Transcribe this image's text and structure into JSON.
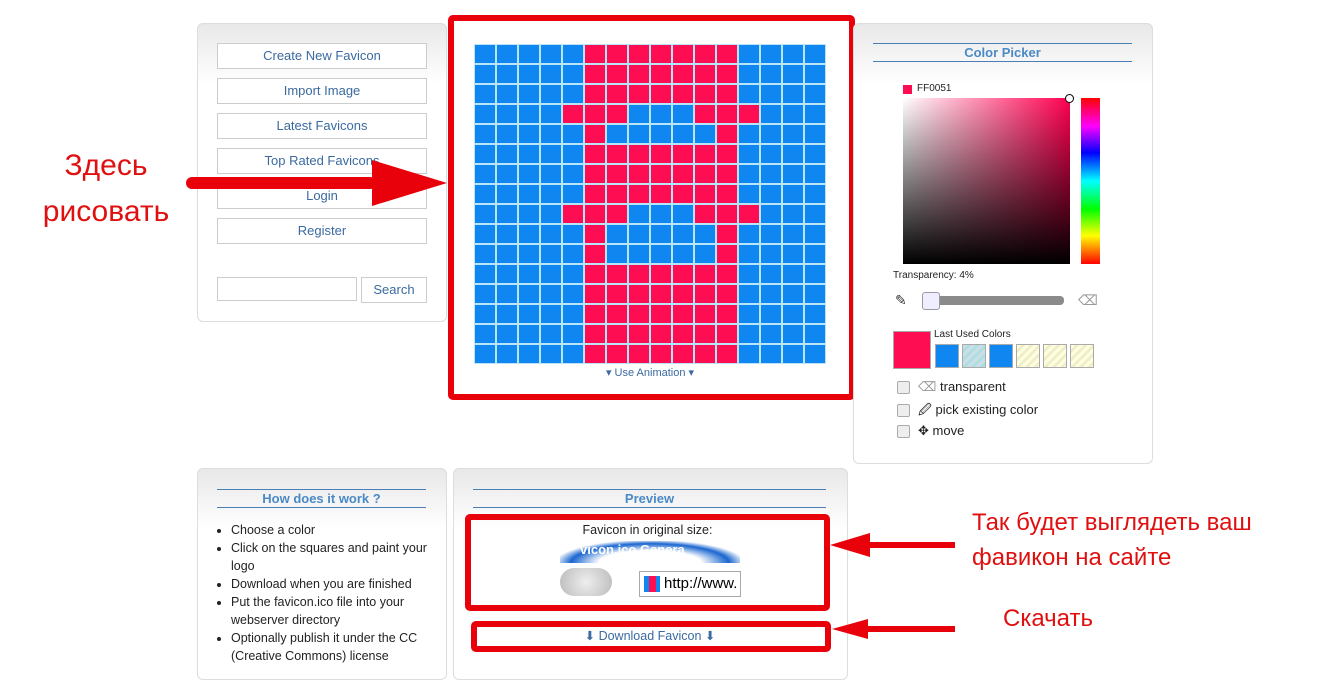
{
  "nav": {
    "items": [
      "Create New Favicon",
      "Import Image",
      "Latest Favicons",
      "Top Rated Favicons",
      "Login",
      "Register"
    ],
    "search_placeholder": "",
    "search_label": "Search"
  },
  "editor": {
    "animation_label": "▾ Use Animation ▾",
    "colors": {
      "B": "#0f86f0",
      "R": "#ff0d52"
    },
    "rows": [
      "BBBBBRRRRRRRBBBB",
      "BBBBBRRRRRRRBBBB",
      "BBBBBRRRRRRRBBBB",
      "BBBBRRRBBBRRRBBB",
      "BBBBBRBBBBBRBBBB",
      "BBBBBRRRRRRRBBBB",
      "BBBBBRRRRRRRBBBB",
      "BBBBBRRRRRRRBBBB",
      "BBBBRRRBBBRRRBBB",
      "BBBBBRBBBBBRBBBB",
      "BBBBBRBBBBBRBBBB",
      "BBBBBRRRRRRRBBBB",
      "BBBBBRRRRRRRBBBB",
      "BBBBBRRRRRRRBBBB",
      "BBBBBRRRRRRRBBBB",
      "BBBBBRRRRRRRBBBB"
    ]
  },
  "picker": {
    "title": "Color Picker",
    "hex": "FF0051",
    "current_color": "#ff0d52",
    "transparency_label": "Transparency: 4%",
    "transparency_percent": 4,
    "last_used_label": "Last Used Colors",
    "last_used": [
      "#0f86f0",
      "transparent-green",
      "#0f86f0",
      "transparent-yellow",
      "transparent-yellow",
      "transparent-yellow"
    ],
    "options": [
      "transparent",
      "pick existing color",
      "move"
    ]
  },
  "how": {
    "title": "How does it work ?",
    "steps": [
      "Choose a color",
      "Click on the squares and paint your logo",
      "Download when you are finished",
      "Put the favicon.ico file into your webserver directory",
      "Optionally publish it under the CC (Creative Commons) license"
    ]
  },
  "preview": {
    "title": "Preview",
    "caption": "Favicon in original size:",
    "browser_title": "vicon.ico Genera",
    "url": "http://www.",
    "download_label": "⬇ Download Favicon ⬇"
  },
  "annotations": {
    "draw_here": "Здесь рисовать",
    "preview_note": "Так будет выглядеть ваш фавикон на сайте",
    "download_note": "Скачать"
  }
}
